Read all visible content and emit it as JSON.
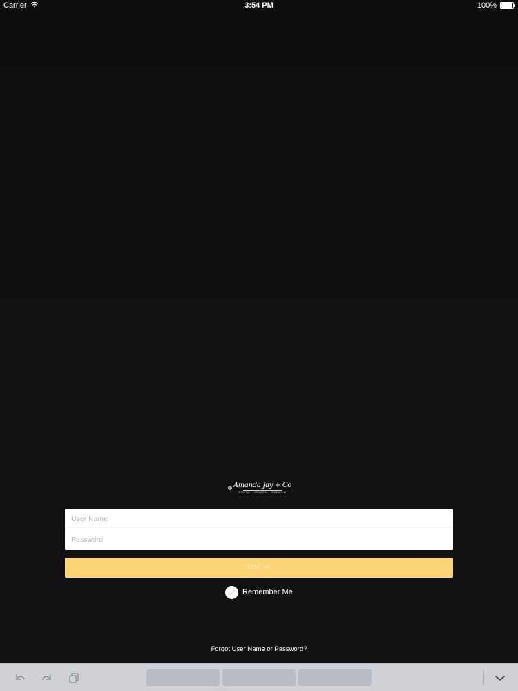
{
  "status_bar": {
    "carrier": "Carrier",
    "time": "3:54 PM",
    "battery": "100%"
  },
  "logo": {
    "script": "Amanda Jay + Co",
    "tagline": "DIGITAL · GENERAL · PREMIUM"
  },
  "login": {
    "username_placeholder": "User Name",
    "password_placeholder": "Password",
    "login_label": "LOG IN",
    "remember_label": "Remember Me",
    "forgot_label": "Forgot User Name or Password?"
  },
  "colors": {
    "background": "#111113",
    "login_button": "#fdd577",
    "keyboard_bar": "#cfd1d7"
  },
  "keyboard_bar": {
    "icons": [
      "undo-icon",
      "redo-icon",
      "paste-icon",
      "chevron-down-icon"
    ],
    "suggestions": [
      "",
      "",
      ""
    ]
  }
}
